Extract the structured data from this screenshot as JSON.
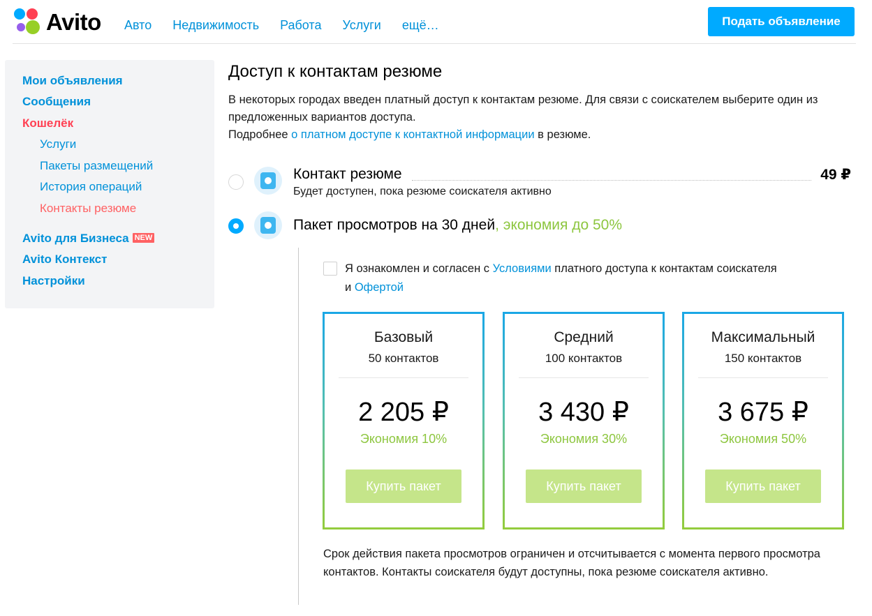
{
  "header": {
    "logo_text": "Avito",
    "nav": [
      "Авто",
      "Недвижимость",
      "Работа",
      "Услуги",
      "ещё…"
    ],
    "post_button": "Подать объявление"
  },
  "sidebar": {
    "items": [
      {
        "label": "Мои объявления"
      },
      {
        "label": "Сообщения"
      },
      {
        "label": "Кошелёк"
      }
    ],
    "sub_items": [
      {
        "label": "Услуги"
      },
      {
        "label": "Пакеты размещений"
      },
      {
        "label": "История операций"
      },
      {
        "label": "Контакты резюме"
      }
    ],
    "business": {
      "label": "Avito для Бизнеса",
      "badge": "NEW"
    },
    "context": {
      "label": "Avito Контекст"
    },
    "settings": {
      "label": "Настройки"
    }
  },
  "main": {
    "title": "Доступ к контактам резюме",
    "intro_line1": "В некоторых городах введен платный доступ к контактам резюме. Для связи с соискателем выберите один из предложенных вариантов доступа.",
    "intro_more_prefix": "Подробнее ",
    "intro_more_link": "о платном доступе к контактной информации",
    "intro_more_suffix": " в резюме.",
    "option1": {
      "title": "Контакт резюме",
      "desc": "Будет доступен, пока резюме соискателя активно",
      "price": "49 ₽"
    },
    "option2": {
      "title": "Пакет просмотров на 30 дней",
      "highlight": ", экономия до 50%"
    },
    "agree": {
      "prefix": "Я ознакомлен и согласен с ",
      "terms_link": "Условиями",
      "middle": " платного доступа к контактам соискателя",
      "and": "и ",
      "offer_link": "Офертой"
    },
    "packages": [
      {
        "name": "Базовый",
        "count": "50 контактов",
        "price": "2 205 ₽",
        "saving": "Экономия 10%",
        "button": "Купить пакет"
      },
      {
        "name": "Средний",
        "count": "100 контактов",
        "price": "3 430 ₽",
        "saving": "Экономия 30%",
        "button": "Купить пакет"
      },
      {
        "name": "Максимальный",
        "count": "150 контактов",
        "price": "3 675 ₽",
        "saving": "Экономия 50%",
        "button": "Купить пакет"
      }
    ],
    "footnote": "Срок действия пакета просмотров ограничен и отсчитывается с момента первого просмотра контактов. Контакты соискателя будут доступны, пока резюме соискателя активно."
  },
  "colors": {
    "accent_blue": "#00aaff",
    "link_blue": "#0091d9",
    "active_red": "#ff4053",
    "saving_green": "#8dc63f",
    "button_green_disabled": "#c5e58a"
  }
}
